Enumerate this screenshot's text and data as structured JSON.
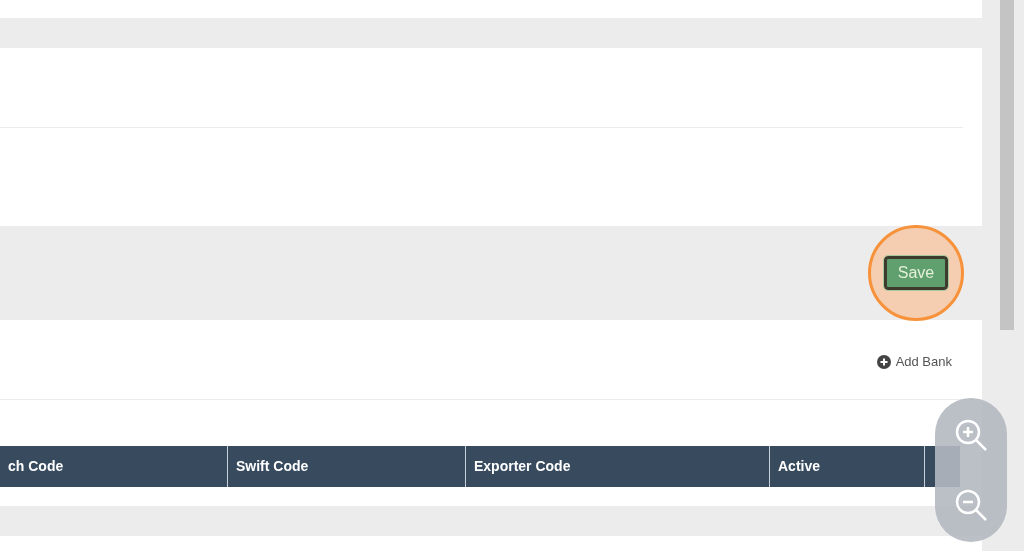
{
  "save_button": {
    "label": "Save"
  },
  "add_bank_link": {
    "label": "Add Bank"
  },
  "table": {
    "columns": [
      "ch Code",
      "Swift Code",
      "Exporter Code",
      "Active"
    ]
  }
}
